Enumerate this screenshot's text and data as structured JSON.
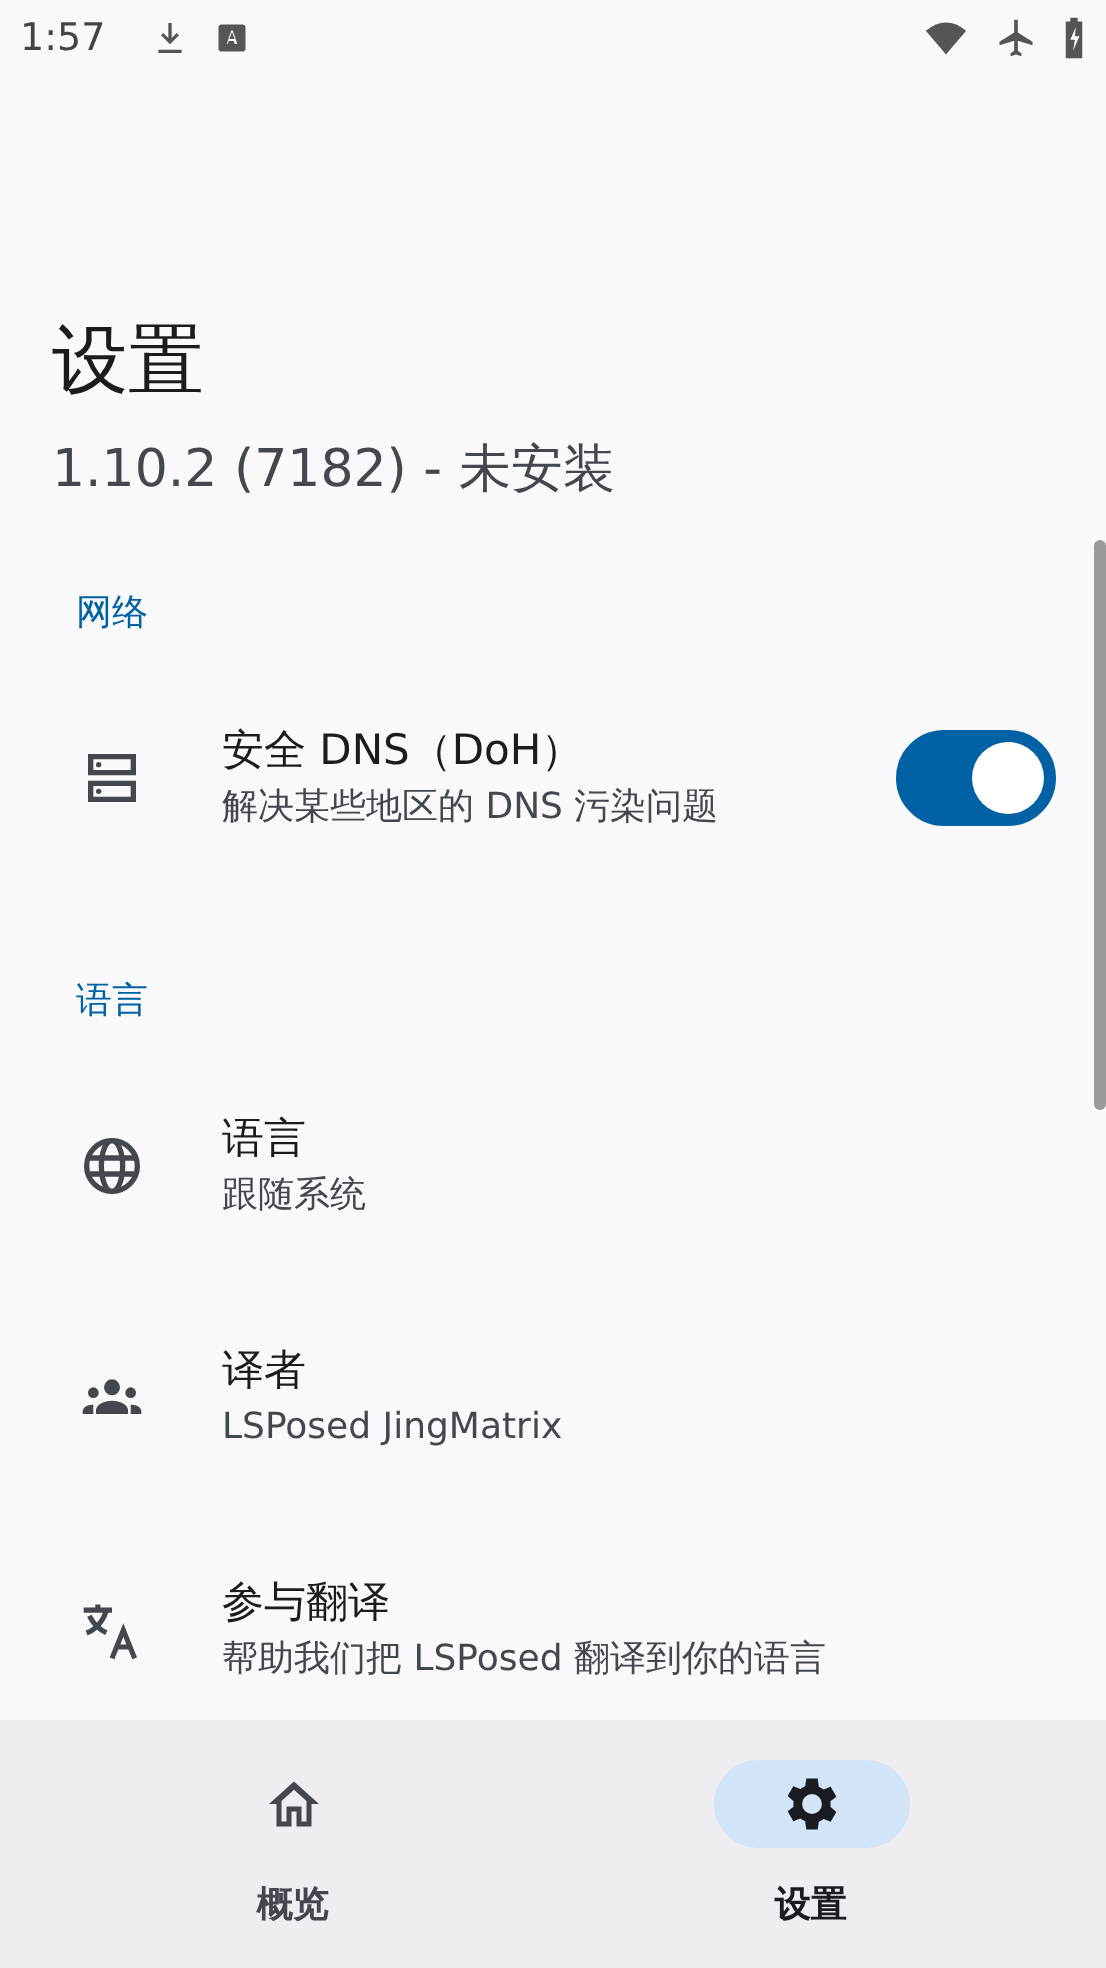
{
  "status_bar": {
    "time": "1:57"
  },
  "header": {
    "title": "设置",
    "subtitle": "1.10.2 (7182) - 未安装"
  },
  "sections": [
    {
      "title": "网络",
      "items": [
        {
          "kind": "switch",
          "title": "安全 DNS（DoH）",
          "summary": "解决某些地区的 DNS 污染问题",
          "on": true
        }
      ]
    },
    {
      "title": "语言",
      "items": [
        {
          "kind": "link",
          "title": "语言",
          "summary": "跟随系统"
        },
        {
          "kind": "link",
          "title": "译者",
          "summary": "LSPosed JingMatrix"
        },
        {
          "kind": "link",
          "title": "参与翻译",
          "summary": "帮助我们把 LSPosed 翻译到你的语言"
        }
      ]
    }
  ],
  "nav": [
    {
      "label": "概览",
      "selected": false
    },
    {
      "label": "设置",
      "selected": true
    }
  ]
}
